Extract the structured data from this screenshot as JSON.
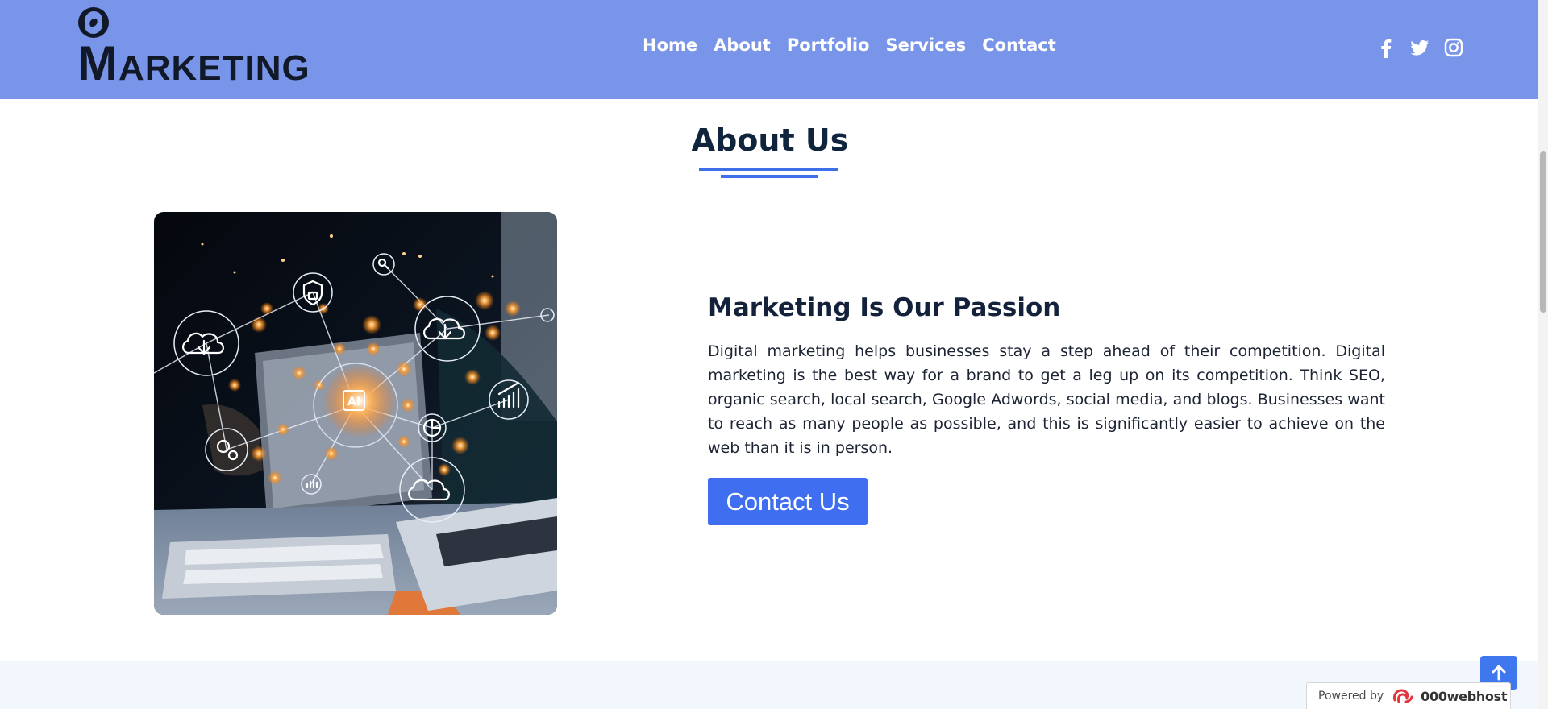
{
  "header": {
    "logo_text_first": "M",
    "logo_text_rest": "ARKETING",
    "nav": [
      "Home",
      "About",
      "Portfolio",
      "Services",
      "Contact"
    ],
    "social_icons": [
      "facebook-icon",
      "twitter-icon",
      "instagram-icon"
    ]
  },
  "about": {
    "title": "About Us",
    "subheading": "Marketing Is Our Passion",
    "paragraph": "Digital marketing helps businesses stay a step ahead of their competition. Digital marketing is the best way for a brand to get a leg up on its competition. Think SEO, organic search, local search, Google Adwords, social media, and blogs. Businesses want to reach as many people as possible, and this is significantly easier to achieve on the web than it is in person.",
    "button_label": "Contact Us",
    "image_overlay_label": "AI"
  },
  "footer": {
    "powered_label": "Powered by",
    "powered_brand": "000webhost"
  },
  "colors": {
    "header_bg": "#7895ea",
    "accent": "#3f6ef0",
    "heading": "#10243e",
    "bottom_band": "#f1f7fd"
  }
}
